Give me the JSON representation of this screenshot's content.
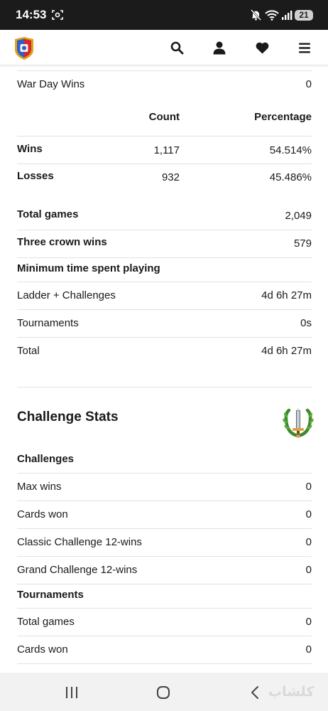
{
  "status_bar": {
    "time": "14:53",
    "battery": "21"
  },
  "header": {
    "icons": [
      "royale-logo-icon",
      "search-icon",
      "user-icon",
      "heart-icon",
      "menu-icon"
    ]
  },
  "war": {
    "label": "War Day Wins",
    "value": "0"
  },
  "stats_table": {
    "header_count": "Count",
    "header_percentage": "Percentage",
    "rows": [
      {
        "label": "Wins",
        "count": "1,117",
        "percentage": "54.514%"
      },
      {
        "label": "Losses",
        "count": "932",
        "percentage": "45.486%"
      }
    ]
  },
  "totals": [
    {
      "label": "Total games",
      "value": "2,049"
    },
    {
      "label": "Three crown wins",
      "value": "579"
    }
  ],
  "time_played": {
    "title": "Minimum time spent playing",
    "rows": [
      {
        "label": "Ladder + Challenges",
        "value": "4d 6h 27m"
      },
      {
        "label": "Tournaments",
        "value": "0s"
      },
      {
        "label": "Total",
        "value": "4d 6h 27m"
      }
    ]
  },
  "challenge_stats": {
    "title": "Challenge Stats",
    "badge_icon": "laurel-sword-icon",
    "challenges": {
      "title": "Challenges",
      "rows": [
        {
          "label": "Max wins",
          "value": "0"
        },
        {
          "label": "Cards won",
          "value": "0"
        },
        {
          "label": "Classic Challenge 12-wins",
          "value": "0"
        },
        {
          "label": "Grand Challenge 12-wins",
          "value": "0"
        }
      ]
    },
    "tournaments": {
      "title": "Tournaments",
      "rows": [
        {
          "label": "Total games",
          "value": "0"
        },
        {
          "label": "Cards won",
          "value": "0"
        }
      ]
    }
  },
  "nav_bar": {
    "icons": [
      "recent-apps-icon",
      "home-icon",
      "back-icon"
    ]
  },
  "watermark": "کلشاپ"
}
